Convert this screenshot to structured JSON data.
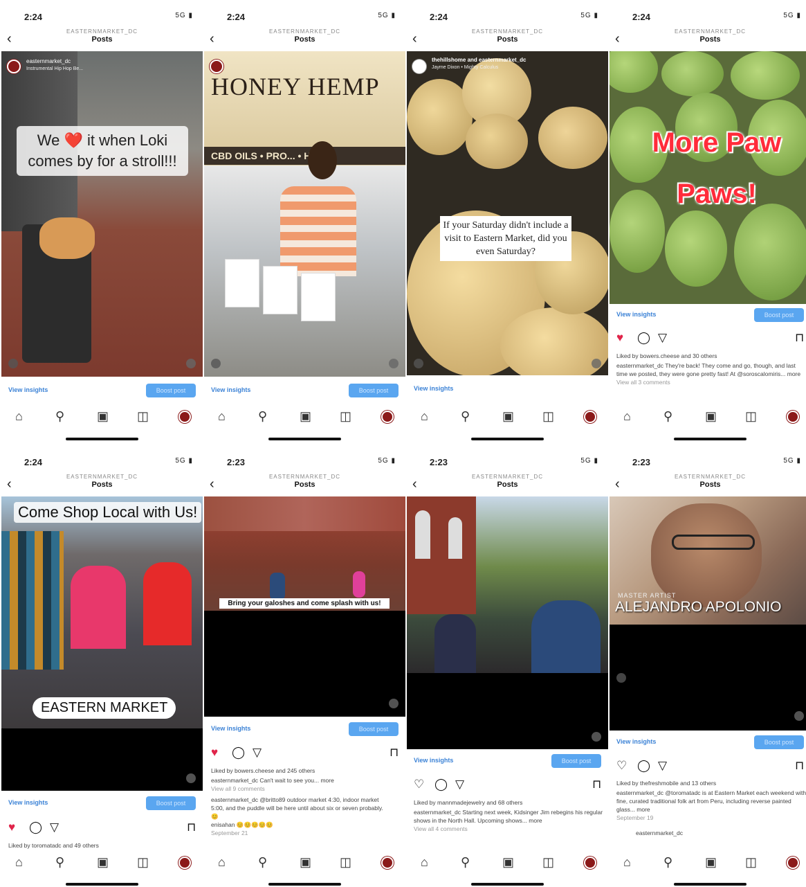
{
  "status": {
    "signal": "5G"
  },
  "header": {
    "account": "EASTERNMARKET_DC",
    "title": "Posts",
    "back": "‹"
  },
  "common": {
    "view_insights": "View insights",
    "boost": "Boost post"
  },
  "nav_icons": [
    "home-icon",
    "search-icon",
    "reels-icon",
    "shop-icon",
    "profile-icon"
  ],
  "colors": {
    "accent": "#3b82d6",
    "heart": "#e0244a",
    "brand": "#8b1a1a"
  },
  "phones": [
    {
      "time": "2:24",
      "overlay_user": "easternmarket_dc",
      "audio": "Instrumental Hip Hop Be...",
      "caption": "We ❤️ it when Loki comes by for a stroll!!!"
    },
    {
      "time": "2:24",
      "sign": "HONEY HEMP",
      "sign_bottom": "CBD OILS • PRO... • HONE"
    },
    {
      "time": "2:24",
      "overlay_user": "thehillshome and easternmarket_dc",
      "audio": "Jayme Dixon • Mighty Calculus",
      "caption": "If your Saturday didn't include a visit to Eastern Market, did you even Saturday?"
    },
    {
      "time": "2:24",
      "caption": "More Paw Paws!",
      "likes": "Liked by bowers.cheese and 30 others",
      "text": "easternmarket_dc They're back! They come and go, though, and last time we posted, they were gone pretty fast! At @soroscalomiris... more",
      "comments": "View all 3 comments"
    },
    {
      "time": "2:24",
      "caption_top": "Come Shop Local with Us!",
      "caption_bottom": "EASTERN MARKET",
      "likes": "Liked by toromatadc and 49 others"
    },
    {
      "time": "2:23",
      "caption": "Bring your galoshes and come splash with us!",
      "likes": "Liked by bowers.cheese and 245 others",
      "text": "easternmarket_dc Can't wait to see you... more",
      "comments": "View all 9 comments",
      "comment1": "easternmarket_dc @britto89 outdoor market 4:30, indoor market 5:00, and the puddle will be here until about six or seven probably. 😊",
      "comment2": "enisahan 😊😊😊😊😊",
      "date": "September 21"
    },
    {
      "time": "2:23",
      "likes": "Liked by mannmadejewelry and 68 others",
      "text": "easternmarket_dc Starting next week, Kidsinger Jim rebegins his regular shows in the North Hall. Upcoming shows... more",
      "comments": "View all 4 comments"
    },
    {
      "time": "2:23",
      "caption_small": "MASTER ARTIST",
      "caption": "ALEJANDRO APOLONIO",
      "likes": "Liked by thefreshmobile and 13 others",
      "text": "easternmarket_dc @toromatadc is at Eastern Market each weekend with fine, curated traditional folk art from Peru, including reverse painted glass... more",
      "date": "September 19",
      "comment_user": "easternmarket_dc"
    }
  ]
}
